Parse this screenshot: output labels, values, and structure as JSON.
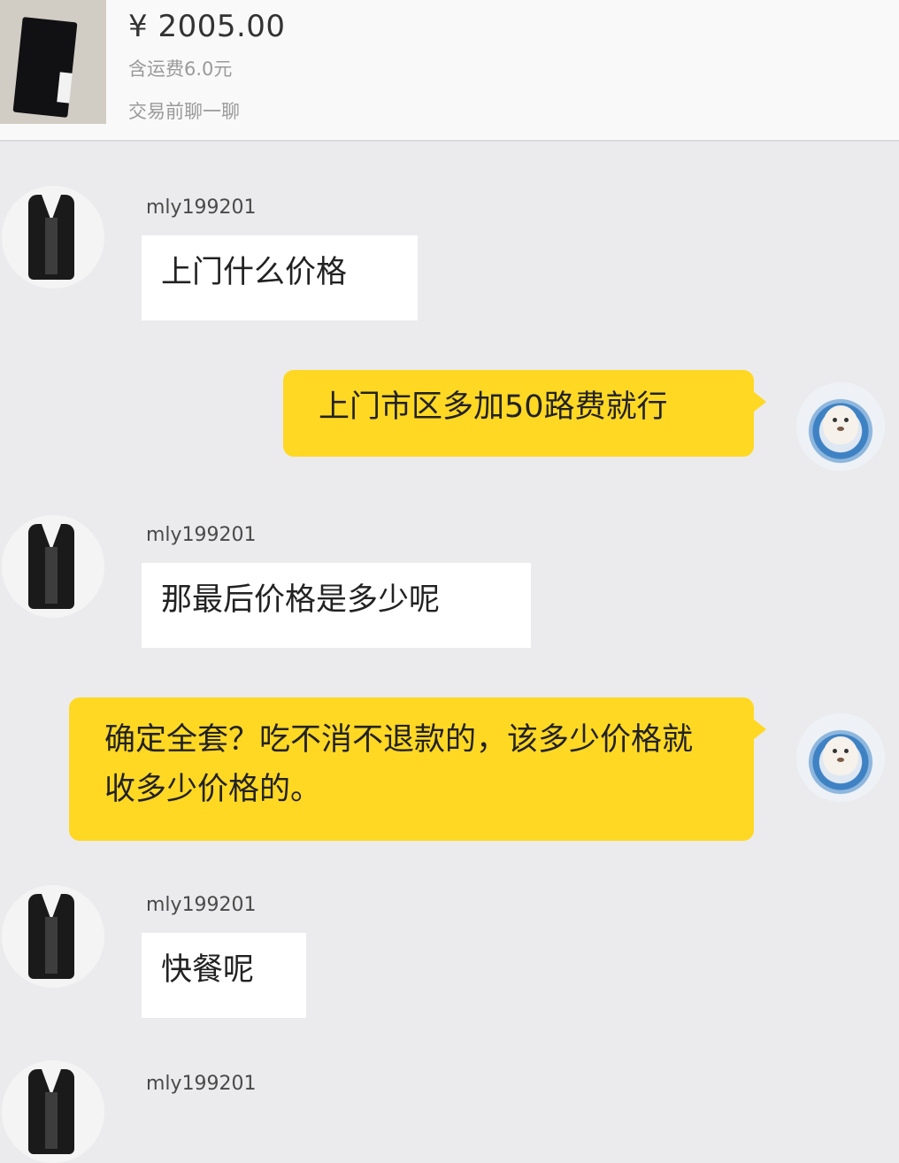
{
  "product": {
    "price": "¥ 2005.00",
    "shipping": "含运费6.0元",
    "cta": "交易前聊一聊"
  },
  "messages": [
    {
      "side": "in",
      "username": "mly199201",
      "text": "上门什么价格"
    },
    {
      "side": "out",
      "text": "上门市区多加50路费就行"
    },
    {
      "side": "in",
      "username": "mly199201",
      "text": "那最后价格是多少呢"
    },
    {
      "side": "out",
      "text": "确定全套？吃不消不退款的，该多少价格就收多少价格的。"
    },
    {
      "side": "in",
      "username": "mly199201",
      "text": "快餐呢"
    },
    {
      "side": "in",
      "username": "mly199201",
      "text": ""
    }
  ]
}
